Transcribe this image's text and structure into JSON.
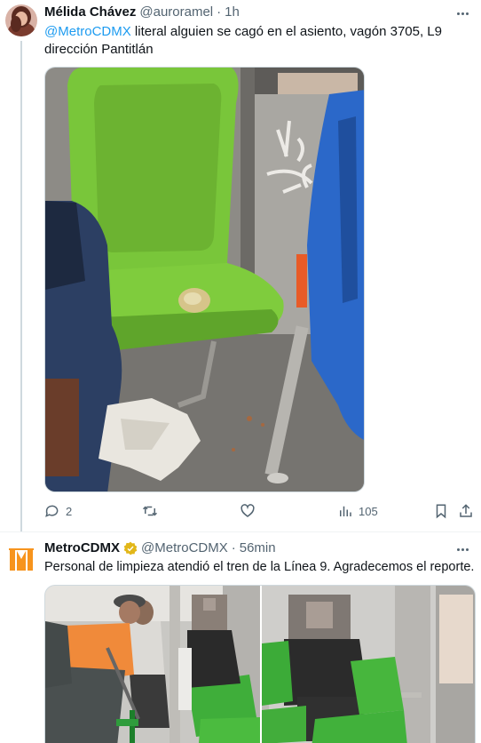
{
  "tweet1": {
    "display_name": "Mélida Chávez",
    "handle": "@auroramel",
    "separator": "·",
    "time": "1h",
    "mention": "@MetroCDMX",
    "body": " literal alguien se cagó en el asiento, vagón 3705, L9 dirección Pantitlán",
    "actions": {
      "reply_count": "2",
      "retweet_count": "",
      "like_count": "",
      "view_count": "105"
    }
  },
  "tweet2": {
    "display_name": "MetroCDMX",
    "handle": "@MetroCDMX",
    "separator": "·",
    "time": "56min",
    "body": "Personal de limpieza atendió el tren de la Línea 9. Agradecemos el reporte.",
    "verified": true
  },
  "colors": {
    "accent": "#1d9bf0",
    "text": "#0f1419",
    "muted": "#536471",
    "metro_orange": "#f7941d",
    "verified_gold": "#e2b719",
    "seat_green": "#7ac943"
  },
  "icons": {
    "reply": "reply-icon",
    "retweet": "retweet-icon",
    "like": "heart-icon",
    "views": "views-icon",
    "bookmark": "bookmark-icon",
    "share": "share-icon",
    "more": "more-icon",
    "verified": "verified-badge-icon"
  }
}
